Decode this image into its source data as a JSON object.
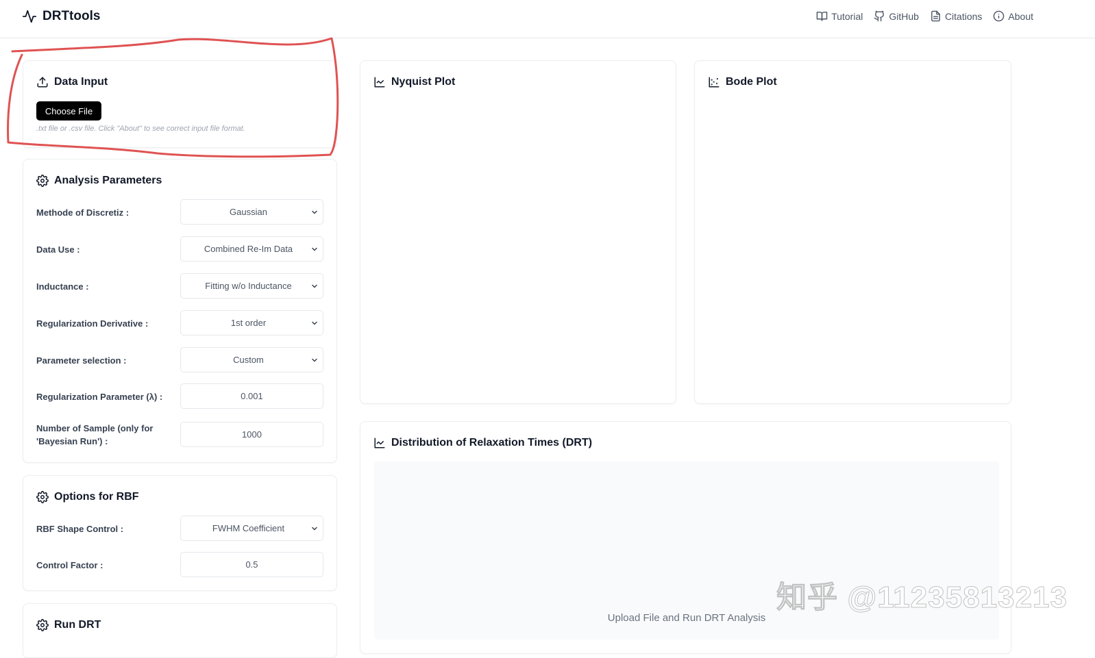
{
  "app": {
    "title": "DRTtools"
  },
  "nav": {
    "tutorial": "Tutorial",
    "github": "GitHub",
    "citations": "Citations",
    "about": "About"
  },
  "data_input": {
    "title": "Data Input",
    "choose_file": "Choose File",
    "hint": ".txt file or .csv file. Click \"About\" to see correct input file format."
  },
  "analysis": {
    "title": "Analysis Parameters",
    "params": [
      {
        "label": "Methode of Discretiz :",
        "value": "Gaussian",
        "type": "select"
      },
      {
        "label": "Data Use :",
        "value": "Combined Re-Im Data",
        "type": "select"
      },
      {
        "label": "Inductance :",
        "value": "Fitting w/o Inductance",
        "type": "select"
      },
      {
        "label": "Regularization Derivative :",
        "value": "1st order",
        "type": "select"
      },
      {
        "label": "Parameter selection :",
        "value": "Custom",
        "type": "select"
      },
      {
        "label": "Regularization Parameter (λ) :",
        "value": "0.001",
        "type": "input"
      },
      {
        "label": "Number of Sample (only for 'Bayesian Run') :",
        "value": "1000",
        "type": "input"
      }
    ]
  },
  "rbf": {
    "title": "Options for RBF",
    "params": [
      {
        "label": "RBF Shape Control :",
        "value": "FWHM Coefficient",
        "type": "select"
      },
      {
        "label": "Control Factor :",
        "value": "0.5",
        "type": "input"
      }
    ]
  },
  "run": {
    "title": "Run DRT"
  },
  "plots": {
    "nyquist_title": "Nyquist Plot",
    "bode_title": "Bode Plot",
    "drt_title": "Distribution of Relaxation Times (DRT)",
    "drt_placeholder": "Upload File and Run DRT Analysis"
  },
  "watermark": "知乎 @11235813213",
  "annotation": {
    "color": "#e05252"
  }
}
